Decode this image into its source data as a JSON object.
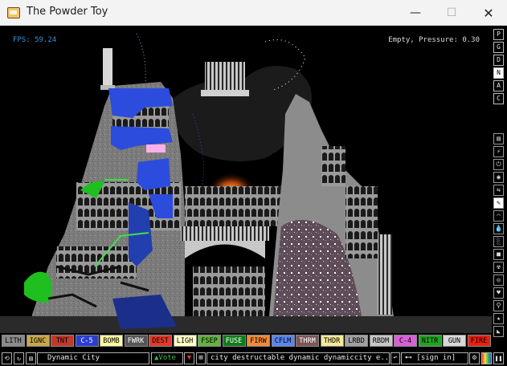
{
  "window": {
    "title": "The Powder Toy",
    "min": "—",
    "max": "☐",
    "close": "✕"
  },
  "hud": {
    "fps": "FPS: 59.24",
    "pressure": "Empty, Pressure: 0.30"
  },
  "right_menu": {
    "toggles": [
      "P",
      "G",
      "D",
      "N",
      "A",
      "C"
    ],
    "active_toggle": "N",
    "categories": [
      {
        "name": "walls",
        "glyph": "▤"
      },
      {
        "name": "electronics",
        "glyph": "⚡"
      },
      {
        "name": "powered",
        "glyph": "⏻"
      },
      {
        "name": "sensors",
        "glyph": "◉"
      },
      {
        "name": "force",
        "glyph": "⇆"
      },
      {
        "name": "explosives",
        "glyph": "✎"
      },
      {
        "name": "gases",
        "glyph": "◠"
      },
      {
        "name": "liquids",
        "glyph": "💧"
      },
      {
        "name": "powders",
        "glyph": "░"
      },
      {
        "name": "solids",
        "glyph": "■"
      },
      {
        "name": "nuclear",
        "glyph": "☢"
      },
      {
        "name": "special",
        "glyph": "◎"
      },
      {
        "name": "life",
        "glyph": "♥"
      },
      {
        "name": "tools",
        "glyph": "⚲"
      },
      {
        "name": "favorites",
        "glyph": "★"
      },
      {
        "name": "more",
        "glyph": "◣"
      }
    ],
    "selected_category": "explosives"
  },
  "elements": [
    {
      "label": "LITH",
      "bg": "#8a8a8a",
      "fg": "#000000"
    },
    {
      "label": "IGNC",
      "bg": "#c8a84a",
      "fg": "#000000"
    },
    {
      "label": "TNT",
      "bg": "#c0392b",
      "fg": "#000000"
    },
    {
      "label": "C-5",
      "bg": "#2a3fd0",
      "fg": "#ffffff"
    },
    {
      "label": "BOMB",
      "bg": "#fff9a0",
      "fg": "#000000"
    },
    {
      "label": "FWRK",
      "bg": "#555555",
      "fg": "#ffffff"
    },
    {
      "label": "DEST",
      "bg": "#e03a2a",
      "fg": "#000000"
    },
    {
      "label": "LIGH",
      "bg": "#ffffc8",
      "fg": "#000000"
    },
    {
      "label": "FSEP",
      "bg": "#63b342",
      "fg": "#000000"
    },
    {
      "label": "FUSE",
      "bg": "#0f7a1a",
      "fg": "#ffffff"
    },
    {
      "label": "FIRW",
      "bg": "#f08b3a",
      "fg": "#000000"
    },
    {
      "label": "CFLM",
      "bg": "#5a86f0",
      "fg": "#000000"
    },
    {
      "label": "THRM",
      "bg": "#7a5656",
      "fg": "#ffffff"
    },
    {
      "label": "THDR",
      "bg": "#f5e89a",
      "fg": "#000000"
    },
    {
      "label": "LRBD",
      "bg": "#a0a0a0",
      "fg": "#000000"
    },
    {
      "label": "RBDM",
      "bg": "#c8c8c8",
      "fg": "#000000"
    },
    {
      "label": "C-4",
      "bg": "#d85fd8",
      "fg": "#000000"
    },
    {
      "label": "NITR",
      "bg": "#23a323",
      "fg": "#000000"
    },
    {
      "label": "GUN",
      "bg": "#d8d8d8",
      "fg": "#000000"
    },
    {
      "label": "FIRE",
      "bg": "#e8200e",
      "fg": "#000000"
    }
  ],
  "bottom_bar": {
    "save_name": "Dynamic City",
    "vote_label": "Vote",
    "tags": "city destructable dynamic dynamiccity e...",
    "sign_in": "[sign in]"
  },
  "colors": {
    "sky": "#000000",
    "stone": "#8c8c8c",
    "water": "#2b4cdc",
    "plant": "#1fbf1f",
    "fire": "#ff7a1a"
  }
}
